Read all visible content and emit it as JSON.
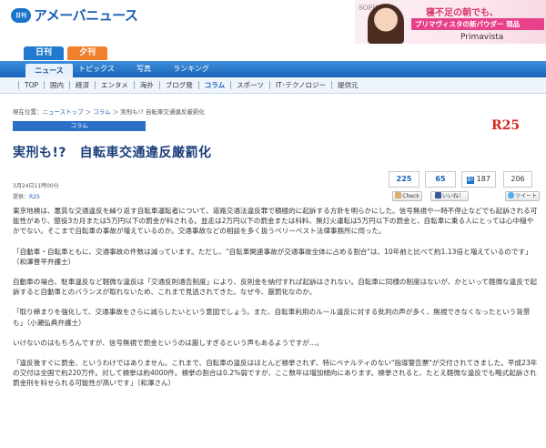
{
  "header": {
    "logo_mark": "日刊",
    "logo_text": "アメーバニュース"
  },
  "ad": {
    "brand": "SOFINA",
    "line1": "寝不足の朝でも、",
    "line2": "プリマヴィスタの新パウダー 現品",
    "line3": "Primavista"
  },
  "edition_tabs": [
    {
      "label": "日刊"
    },
    {
      "label": "夕刊"
    }
  ],
  "main_nav": [
    {
      "label": "ニュース"
    },
    {
      "label": "トピックス"
    },
    {
      "label": "写真"
    },
    {
      "label": "ランキング"
    }
  ],
  "sub_nav": [
    {
      "label": "TOP"
    },
    {
      "label": "国内"
    },
    {
      "label": "経済"
    },
    {
      "label": "エンタメ"
    },
    {
      "label": "海外"
    },
    {
      "label": "ブログ発"
    },
    {
      "label": "コラム"
    },
    {
      "label": "スポーツ"
    },
    {
      "label": "IT･テクノロジー"
    },
    {
      "label": "提供元"
    }
  ],
  "breadcrumb": {
    "prefix": "現在位置：",
    "items": [
      "ニューストップ",
      "コラム",
      "実刑も!? 自転車交通違反厳罰化"
    ],
    "separator": " ＞ "
  },
  "category": {
    "label": "コラム"
  },
  "source_logo": "R25",
  "article": {
    "title": "実刑も!?　自転車交通違反厳罰化",
    "date": "3月24日11時00分",
    "source_label": "提供：",
    "source": "R25",
    "paragraphs": [
      "東京地検は、悪質な交通違反を繰り返す自転車運転者について、道路交通法違反罪で積極的に起訴する方針を明らかにした。信号無視や一時不停止などでも起訴される可能性があり、懲役3カ月または5万円以下の罰金が科される。並走は2万円以下の罰金または科料、無灯火運転は5万円以下の罰金と、自転車に乗る人にとっては心中穏やかでない。そこまで自転車の事故が増えているのか。交通事故などの相談を多く扱うベリーベスト法律事務所に伺った。",
      "「自動車・自転車ともに、交通事故の件数は減っています。ただし、\"自転車関連事故が交通事故全体に占める割合\"は、10年前と比べて約1.13倍と増えているのです」（和澤晋平弁護士）",
      "自動車の場合、駐車違反など軽微な違反は「交通反則通告制度」により、反則金を納付すれば起訴はされない。自転車に同様の制度はないが、かといって軽微な違反で起訴すると自動車とのバランスが取れないため、これまで見逃されてきた。なぜ今、厳罰化なのか。",
      "「取り締まりを強化して、交通事故をさらに減らしたいという意図でしょう。また、自転車利用のルール違反に対する批判の声が多く、無視できなくなったという背景も」（小瀬弘典弁護士）",
      "いけないのはもちろんですが、信号無視で罰金というのは厳しすぎるという声もあるようですが…。",
      "「違反後すぐに罰金、というわけではありません。これまで、自転車の違反はほとんど検挙されず、特にペナルティのない\"指導警告票\"が交付されてきました。平成23年の交付は全国で約220万件。対して検挙は約4000件。検挙の割合は0.2%弱ですが、ここ数年は増加傾向にあります。検挙されると、たとえ軽微な違反でも略式起訴され罰金刑を科せられる可能性が高いです」（和澤さん）"
    ]
  },
  "social": {
    "counts": [
      "225",
      "65"
    ],
    "hatena": "187",
    "total": "206",
    "buttons": [
      "Check",
      "いいね！",
      "ツイート"
    ]
  },
  "colors": {
    "brand_blue": "#1a5fb4",
    "nav_blue": "#1f7ad0",
    "evening_orange": "#f0812c",
    "r25_red": "#d8231f"
  }
}
